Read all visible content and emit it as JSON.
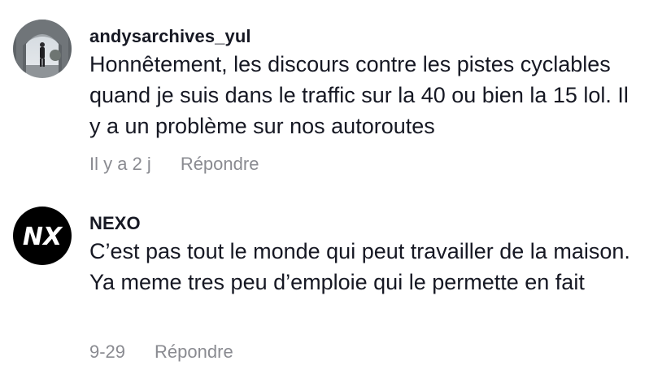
{
  "comments": [
    {
      "username": "andysarchives_yul",
      "avatar_icon": "photo-avatar",
      "text": "Honnêtement, les discours contre les pistes cyclables quand je suis dans le traffic sur la 40 ou bien la 15 lol. Il y a un problème sur nos autoroutes",
      "time": "Il y a 2 j",
      "reply_label": "Répondre"
    },
    {
      "username": "NEXO",
      "avatar_icon": "nx-logo-avatar",
      "avatar_text": "NX",
      "text": "C’est pas tout le monde qui peut travailler de la maison. Ya meme tres peu d’emploie qui le permette en fait",
      "time": "9-29",
      "reply_label": "Répondre"
    }
  ],
  "colors": {
    "text": "#161823",
    "meta": "#8a8b91",
    "background": "#ffffff"
  }
}
